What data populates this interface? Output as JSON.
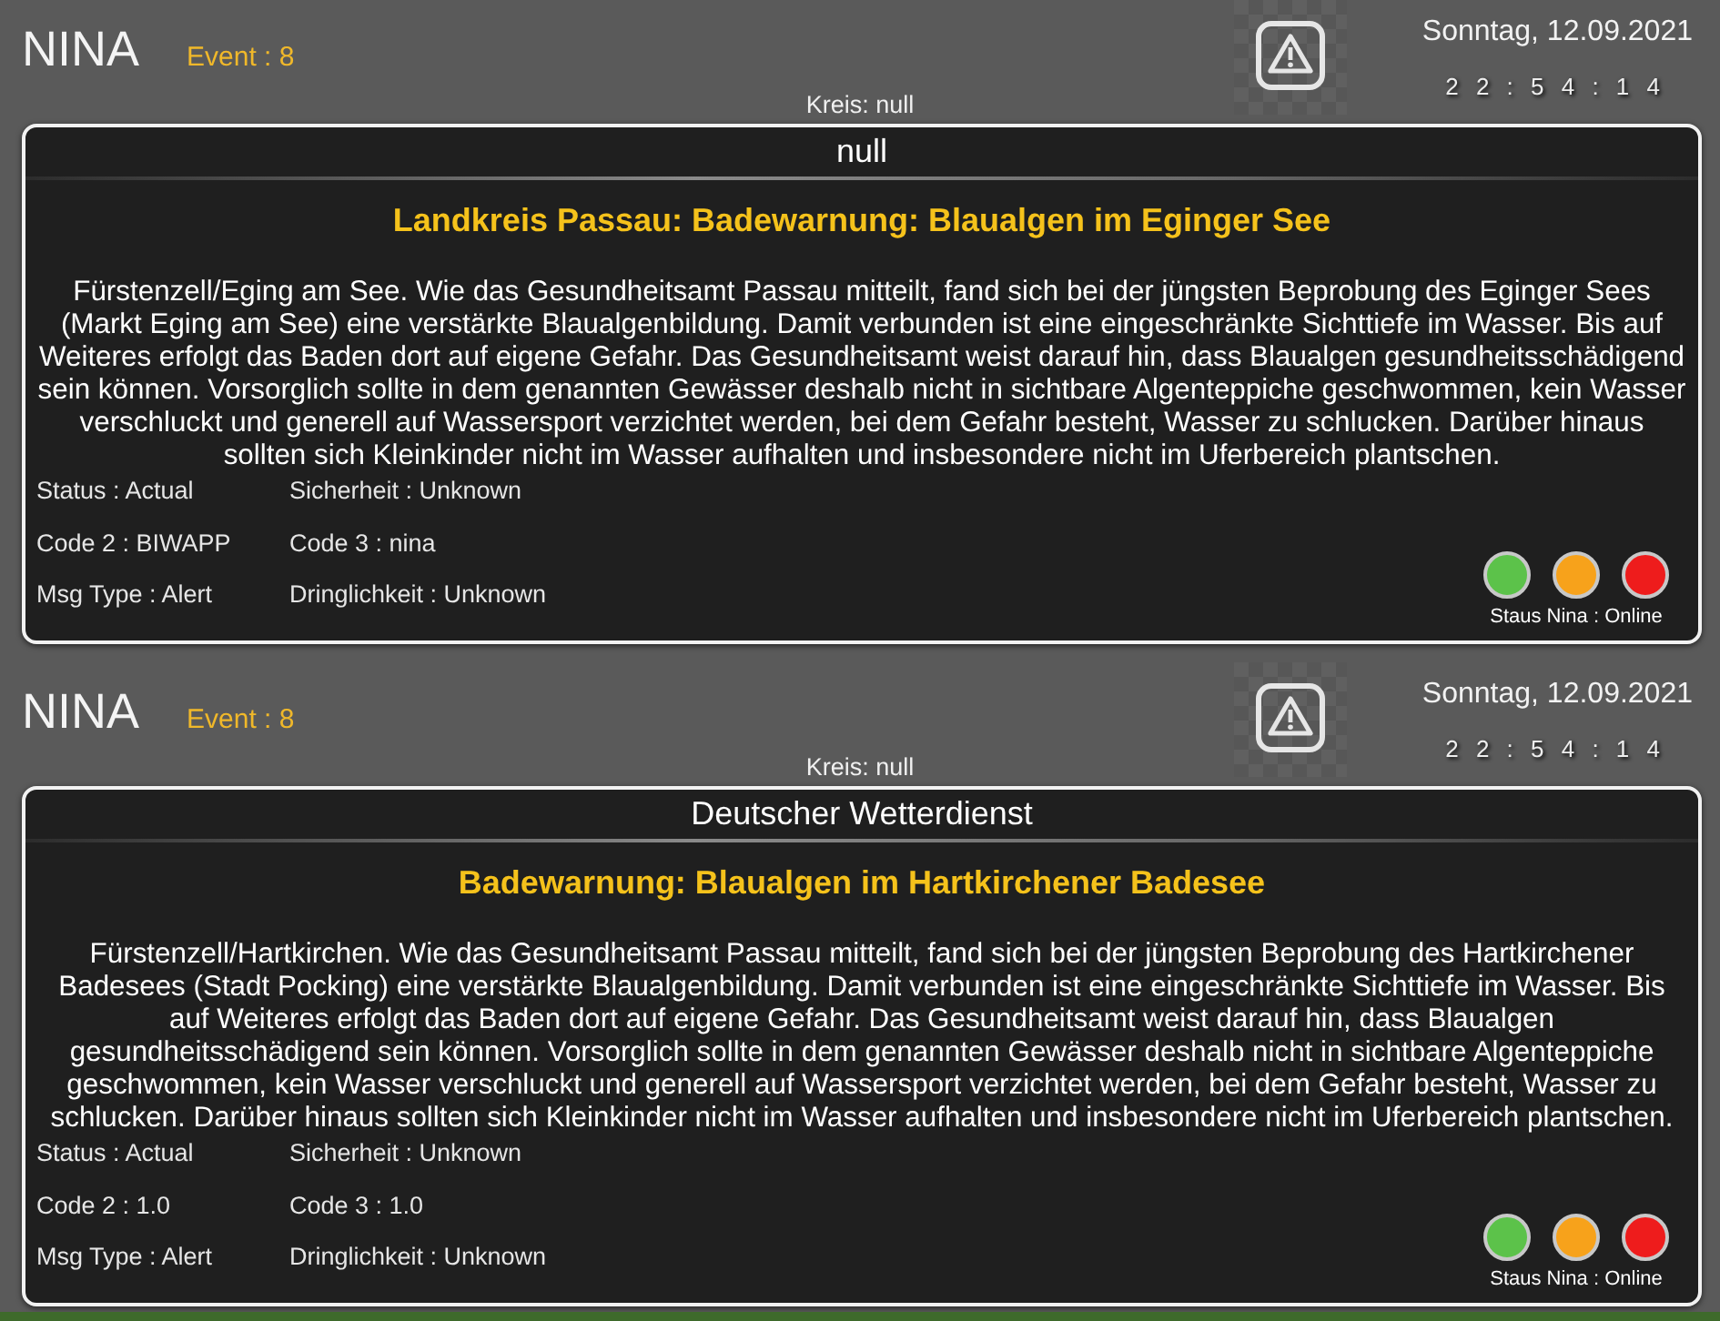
{
  "panels": [
    {
      "app_name": "NINA",
      "event": "Event : 8",
      "date": "Sonntag, 12.09.2021",
      "time": "2 2 : 5 4 : 1 4",
      "district": "Kreis: null",
      "sender": "null",
      "headline": "Landkreis Passau: Badewarnung: Blaualgen im Eginger See",
      "description": "Fürstenzell/Eging am See. Wie das Gesundheitsamt Passau mitteilt, fand sich bei der jüngsten Beprobung des Eginger Sees (Markt Eging am See) eine verstärkte Blaualgenbildung. Damit verbunden ist eine eingeschränkte Sichttiefe im Wasser. Bis auf Weiteres erfolgt das Baden dort auf eigene Gefahr. Das Gesundheitsamt weist darauf hin, dass Blaualgen gesundheitsschädigend sein können. Vorsorglich sollte in dem genannten Gewässer deshalb nicht in sichtbare Algenteppiche geschwommen, kein Wasser verschluckt und generell auf Wassersport verzichtet werden, bei dem Gefahr besteht, Wasser zu schlucken. Darüber hinaus sollten sich Kleinkinder nicht im Wasser aufhalten und insbesondere nicht im Uferbereich plantschen.",
      "fields": [
        "Status : Actual",
        "Sicherheit : Unknown",
        "Code 2 : BIWAPP",
        "Code 3 : nina",
        "Msg Type : Alert",
        "Dringlichkeit : Unknown"
      ],
      "lights": [
        {
          "color": "#5cc24a"
        },
        {
          "color": "#f7a21b"
        },
        {
          "color": "#ee1c1c"
        }
      ],
      "status": "Staus Nina : Online"
    },
    {
      "app_name": "NINA",
      "event": "Event : 8",
      "date": "Sonntag, 12.09.2021",
      "time": "2 2 : 5 4 : 1 4",
      "district": "Kreis: null",
      "sender": "Deutscher Wetterdienst",
      "headline": "Badewarnung: Blaualgen im Hartkirchener Badesee",
      "description": "Fürstenzell/Hartkirchen. Wie das Gesundheitsamt Passau mitteilt, fand sich bei der jüngsten Beprobung des Hartkirchener Badesees (Stadt Pocking) eine verstärkte Blaualgenbildung. Damit verbunden ist eine eingeschränkte Sichttiefe im Wasser. Bis auf Weiteres erfolgt das Baden dort auf eigene Gefahr. Das Gesundheitsamt weist darauf hin, dass Blaualgen gesundheitsschädigend sein können. Vorsorglich sollte in dem genannten Gewässer deshalb nicht in sichtbare Algenteppiche geschwommen, kein Wasser verschluckt und generell auf Wassersport verzichtet werden, bei dem Gefahr besteht, Wasser zu schlucken. Darüber hinaus sollten sich Kleinkinder nicht im Wasser aufhalten und insbesondere nicht im Uferbereich plantschen.",
      "fields": [
        "Status : Actual",
        "Sicherheit : Unknown",
        "Code 2 : 1.0",
        "Code 3 : 1.0",
        "Msg Type : Alert",
        "Dringlichkeit : Unknown"
      ],
      "lights": [
        {
          "color": "#5cc24a"
        },
        {
          "color": "#f7a21b"
        },
        {
          "color": "#ee1c1c"
        }
      ],
      "status": "Staus Nina : Online"
    }
  ]
}
